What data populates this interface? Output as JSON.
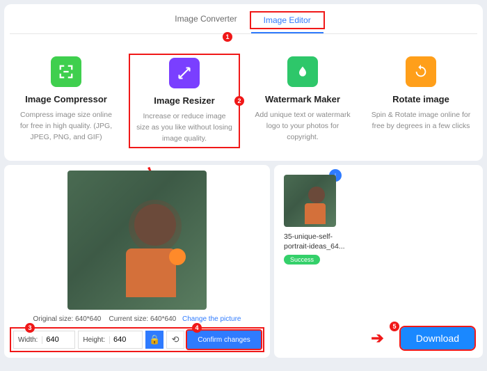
{
  "tabs": {
    "converter": "Image Converter",
    "editor": "Image Editor"
  },
  "badges": {
    "b1": "1",
    "b2": "2",
    "b3": "3",
    "b4": "4",
    "b5": "5"
  },
  "cards": {
    "compressor": {
      "title": "Image Compressor",
      "desc": "Compress image size online for free in high quality. (JPG, JPEG, PNG, and GIF)"
    },
    "resizer": {
      "title": "Image Resizer",
      "desc": "Increase or reduce image size as you like without losing image quality."
    },
    "watermark": {
      "title": "Watermark Maker",
      "desc": "Add unique text or watermark logo to your photos for copyright."
    },
    "rotate": {
      "title": "Rotate image",
      "desc": "Spin & Rotate image online for free by degrees in a few clicks"
    }
  },
  "sizes": {
    "original_label": "Original size:",
    "original": "640*640",
    "current_label": "Current size:",
    "current": "640*640",
    "change": "Change the picture"
  },
  "controls": {
    "width_label": "Width:",
    "width_val": "640",
    "height_label": "Height:",
    "height_val": "640",
    "confirm": "Confirm changes"
  },
  "result": {
    "filename": "35-unique-self-portrait-ideas_64...",
    "status": "Success",
    "download": "Download"
  }
}
